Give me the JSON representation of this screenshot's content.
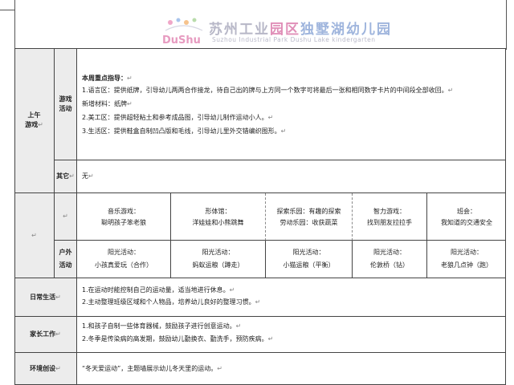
{
  "header": {
    "logo_latin": "DuShu",
    "school_cn_1": "苏州工业",
    "school_cn_2": "园区",
    "school_cn_3": "独墅湖幼儿园",
    "school_en": "Suzhou Industrial Park Dushu Lake kindergarten"
  },
  "rows": {
    "morning": {
      "label_1": "上午",
      "label_2": "游戏",
      "game_label_1": "游戏",
      "game_label_2": "活动",
      "focus_title": "本周重点指导：",
      "lines": [
        "1.语言区：提供纸牌，引导幼儿两两合作接龙，待自己出的牌与上方同一个数字可将最后一张和相同数字卡片的中间段全部收回。",
        "新增材料：纸牌",
        "2.美工区：提供超轻粘土和参考成品图，引导幼儿制作运动小人。",
        "3.生活区：提供鞋盒自制凹凸版和毛线，引导幼儿里外交错编织图形。"
      ],
      "other_label": "其它",
      "other_value": "无"
    },
    "activities": {
      "group_games": [
        {
          "title": "音乐游戏：",
          "name": "聪明孩子笨老狼"
        },
        {
          "title": "形体馆：",
          "name": "洋娃娃和小熊跳舞"
        },
        {
          "title": "探索乐园：有趣的探索",
          "name": "劳动乐园：收获蔬菜"
        },
        {
          "title": "智力游戏：",
          "name": "找到朋友拉拉手"
        },
        {
          "title": "班会：",
          "name": "我知道的交通安全"
        }
      ],
      "outdoor_label_1": "户外",
      "outdoor_label_2": "活动",
      "outdoor": [
        {
          "title": "阳光活动：",
          "name": "小孩真爱玩（合作）"
        },
        {
          "title": "阳光活动：",
          "name": "蚂蚁运粮（蹲走）"
        },
        {
          "title": "阳光活动：",
          "name": "小猫运粮（平衡）"
        },
        {
          "title": "阳光活动：",
          "name": "伦敦桥（钻）"
        },
        {
          "title": "阳光活动：",
          "name": "老狼几点钟（跑）"
        }
      ]
    },
    "daily_life": {
      "label": "日常生活",
      "lines": [
        "1.在运动时能控制自己的运动量，适当地进行休息。",
        "2.主动整理班级区域和个人物品，培养幼儿良好的整理习惯。"
      ]
    },
    "parents": {
      "label": "家长工作",
      "lines": [
        "1.和孩子自制一些体育器械，鼓励孩子进行创意运动。",
        "2.冬季是传染病的高发期，鼓励幼儿勤换衣、勤洗手，预防疾病。"
      ]
    },
    "environment": {
      "label": "环境创设",
      "line": "“冬天爱运动”，主题墙展示幼儿冬天里的运动。"
    }
  },
  "para_mark": "↵"
}
